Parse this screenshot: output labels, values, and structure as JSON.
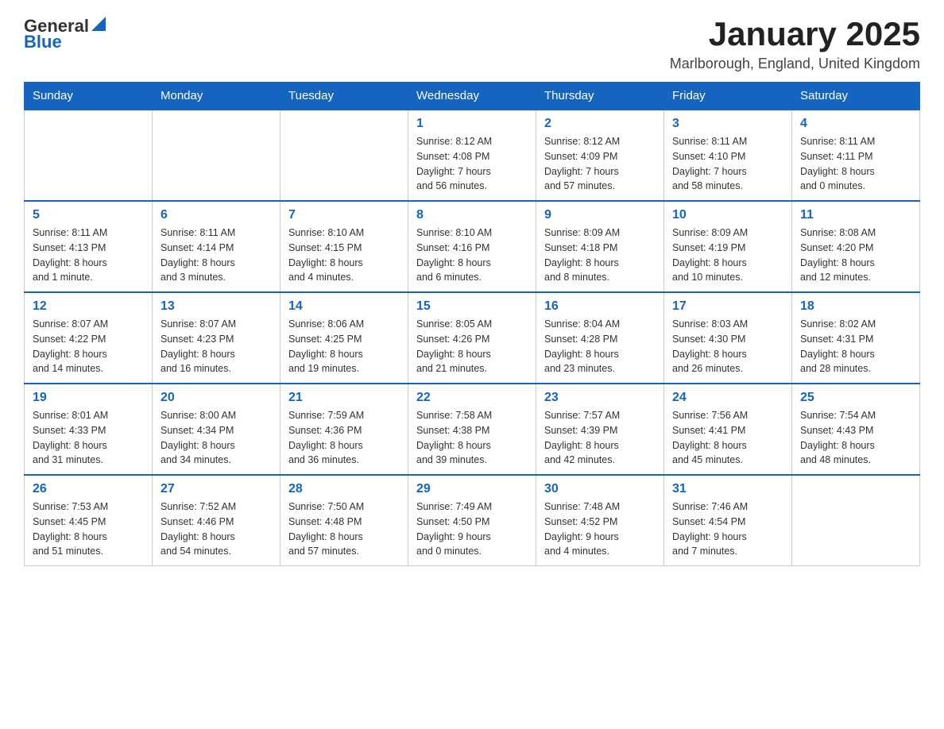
{
  "logo": {
    "text_general": "General",
    "text_blue": "Blue"
  },
  "header": {
    "month_year": "January 2025",
    "location": "Marlborough, England, United Kingdom"
  },
  "days_of_week": [
    "Sunday",
    "Monday",
    "Tuesday",
    "Wednesday",
    "Thursday",
    "Friday",
    "Saturday"
  ],
  "weeks": [
    {
      "days": [
        {
          "number": "",
          "info": ""
        },
        {
          "number": "",
          "info": ""
        },
        {
          "number": "",
          "info": ""
        },
        {
          "number": "1",
          "info": "Sunrise: 8:12 AM\nSunset: 4:08 PM\nDaylight: 7 hours\nand 56 minutes."
        },
        {
          "number": "2",
          "info": "Sunrise: 8:12 AM\nSunset: 4:09 PM\nDaylight: 7 hours\nand 57 minutes."
        },
        {
          "number": "3",
          "info": "Sunrise: 8:11 AM\nSunset: 4:10 PM\nDaylight: 7 hours\nand 58 minutes."
        },
        {
          "number": "4",
          "info": "Sunrise: 8:11 AM\nSunset: 4:11 PM\nDaylight: 8 hours\nand 0 minutes."
        }
      ]
    },
    {
      "days": [
        {
          "number": "5",
          "info": "Sunrise: 8:11 AM\nSunset: 4:13 PM\nDaylight: 8 hours\nand 1 minute."
        },
        {
          "number": "6",
          "info": "Sunrise: 8:11 AM\nSunset: 4:14 PM\nDaylight: 8 hours\nand 3 minutes."
        },
        {
          "number": "7",
          "info": "Sunrise: 8:10 AM\nSunset: 4:15 PM\nDaylight: 8 hours\nand 4 minutes."
        },
        {
          "number": "8",
          "info": "Sunrise: 8:10 AM\nSunset: 4:16 PM\nDaylight: 8 hours\nand 6 minutes."
        },
        {
          "number": "9",
          "info": "Sunrise: 8:09 AM\nSunset: 4:18 PM\nDaylight: 8 hours\nand 8 minutes."
        },
        {
          "number": "10",
          "info": "Sunrise: 8:09 AM\nSunset: 4:19 PM\nDaylight: 8 hours\nand 10 minutes."
        },
        {
          "number": "11",
          "info": "Sunrise: 8:08 AM\nSunset: 4:20 PM\nDaylight: 8 hours\nand 12 minutes."
        }
      ]
    },
    {
      "days": [
        {
          "number": "12",
          "info": "Sunrise: 8:07 AM\nSunset: 4:22 PM\nDaylight: 8 hours\nand 14 minutes."
        },
        {
          "number": "13",
          "info": "Sunrise: 8:07 AM\nSunset: 4:23 PM\nDaylight: 8 hours\nand 16 minutes."
        },
        {
          "number": "14",
          "info": "Sunrise: 8:06 AM\nSunset: 4:25 PM\nDaylight: 8 hours\nand 19 minutes."
        },
        {
          "number": "15",
          "info": "Sunrise: 8:05 AM\nSunset: 4:26 PM\nDaylight: 8 hours\nand 21 minutes."
        },
        {
          "number": "16",
          "info": "Sunrise: 8:04 AM\nSunset: 4:28 PM\nDaylight: 8 hours\nand 23 minutes."
        },
        {
          "number": "17",
          "info": "Sunrise: 8:03 AM\nSunset: 4:30 PM\nDaylight: 8 hours\nand 26 minutes."
        },
        {
          "number": "18",
          "info": "Sunrise: 8:02 AM\nSunset: 4:31 PM\nDaylight: 8 hours\nand 28 minutes."
        }
      ]
    },
    {
      "days": [
        {
          "number": "19",
          "info": "Sunrise: 8:01 AM\nSunset: 4:33 PM\nDaylight: 8 hours\nand 31 minutes."
        },
        {
          "number": "20",
          "info": "Sunrise: 8:00 AM\nSunset: 4:34 PM\nDaylight: 8 hours\nand 34 minutes."
        },
        {
          "number": "21",
          "info": "Sunrise: 7:59 AM\nSunset: 4:36 PM\nDaylight: 8 hours\nand 36 minutes."
        },
        {
          "number": "22",
          "info": "Sunrise: 7:58 AM\nSunset: 4:38 PM\nDaylight: 8 hours\nand 39 minutes."
        },
        {
          "number": "23",
          "info": "Sunrise: 7:57 AM\nSunset: 4:39 PM\nDaylight: 8 hours\nand 42 minutes."
        },
        {
          "number": "24",
          "info": "Sunrise: 7:56 AM\nSunset: 4:41 PM\nDaylight: 8 hours\nand 45 minutes."
        },
        {
          "number": "25",
          "info": "Sunrise: 7:54 AM\nSunset: 4:43 PM\nDaylight: 8 hours\nand 48 minutes."
        }
      ]
    },
    {
      "days": [
        {
          "number": "26",
          "info": "Sunrise: 7:53 AM\nSunset: 4:45 PM\nDaylight: 8 hours\nand 51 minutes."
        },
        {
          "number": "27",
          "info": "Sunrise: 7:52 AM\nSunset: 4:46 PM\nDaylight: 8 hours\nand 54 minutes."
        },
        {
          "number": "28",
          "info": "Sunrise: 7:50 AM\nSunset: 4:48 PM\nDaylight: 8 hours\nand 57 minutes."
        },
        {
          "number": "29",
          "info": "Sunrise: 7:49 AM\nSunset: 4:50 PM\nDaylight: 9 hours\nand 0 minutes."
        },
        {
          "number": "30",
          "info": "Sunrise: 7:48 AM\nSunset: 4:52 PM\nDaylight: 9 hours\nand 4 minutes."
        },
        {
          "number": "31",
          "info": "Sunrise: 7:46 AM\nSunset: 4:54 PM\nDaylight: 9 hours\nand 7 minutes."
        },
        {
          "number": "",
          "info": ""
        }
      ]
    }
  ]
}
